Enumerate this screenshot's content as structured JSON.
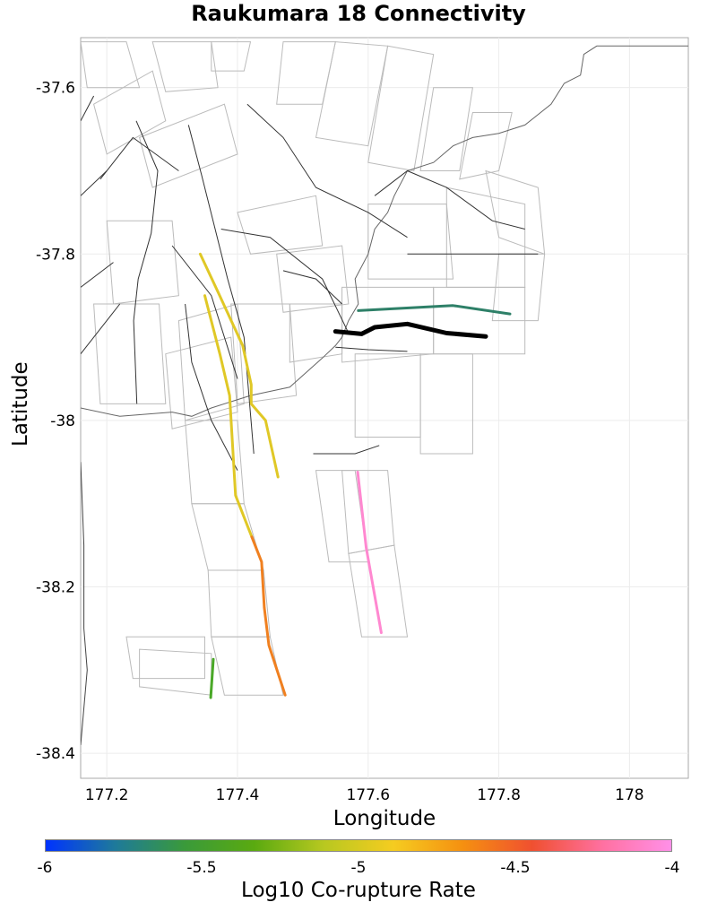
{
  "title": "Raukumara 18 Connectivity",
  "chart_data": {
    "type": "map",
    "title": "Raukumara 18 Connectivity",
    "xlabel": "Longitude",
    "ylabel": "Latitude",
    "xlim": [
      177.16,
      178.09
    ],
    "ylim": [
      -38.43,
      -37.54
    ],
    "xticks": [
      "177.2",
      "177.4",
      "177.6",
      "177.8",
      "178"
    ],
    "xtick_values": [
      177.2,
      177.4,
      177.6,
      177.8,
      178.0
    ],
    "yticks": [
      "-37.6",
      "-37.8",
      "-38",
      "-38.2",
      "-38.4"
    ],
    "ytick_values": [
      -37.6,
      -37.8,
      -38.0,
      -38.2,
      -38.4
    ],
    "grid": true,
    "colorbar": {
      "label": "Log10 Co-rupture Rate",
      "ticks": [
        "-6",
        "-5.5",
        "-5",
        "-4.5",
        "-4"
      ],
      "range": [
        -6,
        -4
      ],
      "colors": [
        "#0033ff",
        "#1e7a9a",
        "#3a9a3a",
        "#5aaa10",
        "#b8c820",
        "#f5cc20",
        "#f59010",
        "#f05030",
        "#ff70a0",
        "#ff90e8"
      ]
    },
    "target_section": {
      "name": "Raukumara 18",
      "color": "#000000",
      "points": [
        [
          177.55,
          -37.893
        ],
        [
          177.59,
          -37.896
        ],
        [
          177.61,
          -37.888
        ],
        [
          177.66,
          -37.884
        ],
        [
          177.72,
          -37.895
        ],
        [
          177.78,
          -37.899
        ]
      ]
    },
    "ruptures": [
      {
        "log10_rate": -5.6,
        "color": "#2e8068",
        "points": [
          [
            177.585,
            -37.868
          ],
          [
            177.73,
            -37.862
          ],
          [
            177.817,
            -37.872
          ]
        ]
      },
      {
        "log10_rate": -5.0,
        "color": "#e0c826",
        "points": [
          [
            177.343,
            -37.8
          ],
          [
            177.371,
            -37.847
          ],
          [
            177.408,
            -37.91
          ],
          [
            177.421,
            -37.957
          ],
          [
            177.421,
            -37.98
          ],
          [
            177.443,
            -38.0
          ],
          [
            177.462,
            -38.068
          ]
        ]
      },
      {
        "log10_rate": -5.0,
        "color": "#e0c826",
        "points": [
          [
            177.35,
            -37.85
          ],
          [
            177.373,
            -37.92
          ],
          [
            177.388,
            -37.97
          ],
          [
            177.397,
            -38.09
          ],
          [
            177.422,
            -38.14
          ]
        ]
      },
      {
        "log10_rate": -4.7,
        "color": "#f08020",
        "points": [
          [
            177.422,
            -38.14
          ],
          [
            177.437,
            -38.17
          ],
          [
            177.441,
            -38.225
          ],
          [
            177.448,
            -38.27
          ],
          [
            177.473,
            -38.33
          ]
        ]
      },
      {
        "log10_rate": -4.05,
        "color": "#ff88d0",
        "points": [
          [
            177.584,
            -38.062
          ],
          [
            177.597,
            -38.153
          ],
          [
            177.62,
            -38.255
          ]
        ]
      },
      {
        "log10_rate": -5.45,
        "color": "#4aa828",
        "points": [
          [
            177.363,
            -38.287
          ],
          [
            177.359,
            -38.333
          ]
        ]
      }
    ],
    "regional_faults": [
      [
        [
          177.245,
          -37.64
        ],
        [
          177.278,
          -37.7
        ],
        [
          177.268,
          -37.775
        ],
        [
          177.248,
          -37.83
        ],
        [
          177.241,
          -37.88
        ],
        [
          177.246,
          -37.98
        ]
      ],
      [
        [
          177.19,
          -37.71
        ],
        [
          177.24,
          -37.66
        ],
        [
          177.31,
          -37.7
        ]
      ],
      [
        [
          177.325,
          -37.645
        ],
        [
          177.345,
          -37.705
        ],
        [
          177.385,
          -37.83
        ],
        [
          177.41,
          -37.9
        ],
        [
          177.425,
          -38.04
        ]
      ],
      [
        [
          177.3,
          -37.79
        ],
        [
          177.36,
          -37.85
        ],
        [
          177.4,
          -37.95
        ]
      ],
      [
        [
          177.32,
          -37.86
        ],
        [
          177.33,
          -37.93
        ],
        [
          177.36,
          -38.0
        ],
        [
          177.4,
          -38.06
        ]
      ],
      [
        [
          177.375,
          -37.77
        ],
        [
          177.45,
          -37.78
        ],
        [
          177.53,
          -37.83
        ],
        [
          177.57,
          -37.895
        ]
      ],
      [
        [
          177.415,
          -37.62
        ],
        [
          177.47,
          -37.66
        ],
        [
          177.52,
          -37.72
        ],
        [
          177.6,
          -37.75
        ],
        [
          177.66,
          -37.78
        ]
      ],
      [
        [
          177.61,
          -37.73
        ],
        [
          177.66,
          -37.7
        ],
        [
          177.72,
          -37.72
        ],
        [
          177.79,
          -37.76
        ],
        [
          177.84,
          -37.77
        ]
      ],
      [
        [
          177.47,
          -37.82
        ],
        [
          177.52,
          -37.83
        ],
        [
          177.56,
          -37.86
        ]
      ],
      [
        [
          177.66,
          -37.8
        ],
        [
          177.75,
          -37.8
        ],
        [
          177.86,
          -37.8
        ]
      ],
      [
        [
          177.55,
          -37.912
        ],
        [
          177.6,
          -37.915
        ],
        [
          177.66,
          -37.917
        ]
      ],
      [
        [
          177.516,
          -38.04
        ],
        [
          177.58,
          -38.04
        ],
        [
          177.617,
          -38.03
        ]
      ],
      [
        [
          177.16,
          -37.73
        ],
        [
          177.2,
          -37.7
        ]
      ],
      [
        [
          177.16,
          -37.84
        ],
        [
          177.21,
          -37.81
        ]
      ],
      [
        [
          177.16,
          -37.92
        ],
        [
          177.22,
          -37.86
        ]
      ],
      [
        [
          177.16,
          -37.64
        ],
        [
          177.18,
          -37.61
        ]
      ]
    ],
    "coastline": [
      [
        177.16,
        -37.985
      ],
      [
        177.22,
        -37.995
      ],
      [
        177.3,
        -37.99
      ],
      [
        177.33,
        -37.995
      ],
      [
        177.36,
        -37.985
      ],
      [
        177.42,
        -37.97
      ],
      [
        177.48,
        -37.96
      ],
      [
        177.53,
        -37.925
      ],
      [
        177.55,
        -37.91
      ],
      [
        177.56,
        -37.9
      ],
      [
        177.57,
        -37.88
      ],
      [
        177.585,
        -37.86
      ],
      [
        177.58,
        -37.83
      ],
      [
        177.6,
        -37.8
      ],
      [
        177.61,
        -37.77
      ],
      [
        177.63,
        -37.75
      ],
      [
        177.64,
        -37.73
      ],
      [
        177.66,
        -37.7
      ],
      [
        177.7,
        -37.69
      ],
      [
        177.73,
        -37.67
      ],
      [
        177.76,
        -37.66
      ],
      [
        177.8,
        -37.655
      ],
      [
        177.84,
        -37.645
      ],
      [
        177.88,
        -37.62
      ],
      [
        177.9,
        -37.595
      ],
      [
        177.925,
        -37.585
      ],
      [
        177.93,
        -37.56
      ],
      [
        177.95,
        -37.55
      ],
      [
        177.99,
        -37.55
      ],
      [
        178.09,
        -37.55
      ]
    ],
    "southwest_coast": [
      [
        177.16,
        -38.05
      ],
      [
        177.165,
        -38.15
      ],
      [
        177.165,
        -38.25
      ],
      [
        177.17,
        -38.3
      ],
      [
        177.16,
        -38.39
      ]
    ],
    "subsection_polygons": [
      [
        [
          177.36,
          -38.26
        ],
        [
          177.45,
          -38.26
        ],
        [
          177.47,
          -38.33
        ],
        [
          177.38,
          -38.33
        ]
      ],
      [
        [
          177.355,
          -38.18
        ],
        [
          177.44,
          -38.18
        ],
        [
          177.45,
          -38.26
        ],
        [
          177.36,
          -38.26
        ]
      ],
      [
        [
          177.33,
          -38.1
        ],
        [
          177.41,
          -38.1
        ],
        [
          177.44,
          -38.18
        ],
        [
          177.355,
          -38.18
        ]
      ],
      [
        [
          177.32,
          -38.0
        ],
        [
          177.4,
          -38.0
        ],
        [
          177.41,
          -38.1
        ],
        [
          177.33,
          -38.1
        ]
      ],
      [
        [
          177.31,
          -37.88
        ],
        [
          177.4,
          -37.86
        ],
        [
          177.41,
          -37.98
        ],
        [
          177.32,
          -38.0
        ]
      ],
      [
        [
          177.23,
          -38.26
        ],
        [
          177.35,
          -38.26
        ],
        [
          177.35,
          -38.31
        ],
        [
          177.24,
          -38.31
        ]
      ],
      [
        [
          177.25,
          -38.275
        ],
        [
          177.36,
          -38.28
        ],
        [
          177.36,
          -38.33
        ],
        [
          177.25,
          -38.32
        ]
      ],
      [
        [
          177.56,
          -38.06
        ],
        [
          177.63,
          -38.06
        ],
        [
          177.64,
          -38.15
        ],
        [
          177.57,
          -38.16
        ]
      ],
      [
        [
          177.57,
          -38.16
        ],
        [
          177.64,
          -38.15
        ],
        [
          177.66,
          -38.26
        ],
        [
          177.59,
          -38.26
        ]
      ],
      [
        [
          177.52,
          -38.06
        ],
        [
          177.58,
          -38.06
        ],
        [
          177.6,
          -38.17
        ],
        [
          177.54,
          -38.17
        ]
      ],
      [
        [
          177.56,
          -37.84
        ],
        [
          177.7,
          -37.84
        ],
        [
          177.7,
          -37.92
        ],
        [
          177.56,
          -37.93
        ]
      ],
      [
        [
          177.7,
          -37.84
        ],
        [
          177.84,
          -37.84
        ],
        [
          177.84,
          -37.92
        ],
        [
          177.7,
          -37.92
        ]
      ],
      [
        [
          177.58,
          -37.92
        ],
        [
          177.68,
          -37.92
        ],
        [
          177.68,
          -38.02
        ],
        [
          177.58,
          -38.02
        ]
      ],
      [
        [
          177.68,
          -37.92
        ],
        [
          177.76,
          -37.92
        ],
        [
          177.76,
          -38.04
        ],
        [
          177.68,
          -38.04
        ]
      ],
      [
        [
          177.6,
          -37.74
        ],
        [
          177.72,
          -37.74
        ],
        [
          177.73,
          -37.83
        ],
        [
          177.6,
          -37.83
        ]
      ],
      [
        [
          177.72,
          -37.72
        ],
        [
          177.84,
          -37.74
        ],
        [
          177.84,
          -37.84
        ],
        [
          177.72,
          -37.84
        ]
      ],
      [
        [
          177.46,
          -37.8
        ],
        [
          177.56,
          -37.79
        ],
        [
          177.57,
          -37.86
        ],
        [
          177.47,
          -37.87
        ]
      ],
      [
        [
          177.4,
          -37.75
        ],
        [
          177.52,
          -37.73
        ],
        [
          177.53,
          -37.79
        ],
        [
          177.42,
          -37.8
        ]
      ],
      [
        [
          177.2,
          -37.76
        ],
        [
          177.3,
          -37.76
        ],
        [
          177.31,
          -37.85
        ],
        [
          177.21,
          -37.86
        ]
      ],
      [
        [
          177.18,
          -37.86
        ],
        [
          177.28,
          -37.86
        ],
        [
          177.29,
          -37.98
        ],
        [
          177.19,
          -37.98
        ]
      ],
      [
        [
          177.29,
          -37.92
        ],
        [
          177.39,
          -37.9
        ],
        [
          177.4,
          -37.99
        ],
        [
          177.3,
          -38.01
        ]
      ],
      [
        [
          177.39,
          -37.86
        ],
        [
          177.48,
          -37.86
        ],
        [
          177.49,
          -37.97
        ],
        [
          177.4,
          -37.98
        ]
      ],
      [
        [
          177.25,
          -37.66
        ],
        [
          177.38,
          -37.62
        ],
        [
          177.4,
          -37.68
        ],
        [
          177.27,
          -37.72
        ]
      ],
      [
        [
          177.18,
          -37.62
        ],
        [
          177.27,
          -37.58
        ],
        [
          177.29,
          -37.64
        ],
        [
          177.2,
          -37.68
        ]
      ],
      [
        [
          177.27,
          -37.545
        ],
        [
          177.36,
          -37.545
        ],
        [
          177.37,
          -37.6
        ],
        [
          177.29,
          -37.605
        ]
      ],
      [
        [
          177.36,
          -37.545
        ],
        [
          177.42,
          -37.545
        ],
        [
          177.41,
          -37.58
        ],
        [
          177.36,
          -37.58
        ]
      ],
      [
        [
          177.16,
          -37.545
        ],
        [
          177.23,
          -37.545
        ],
        [
          177.25,
          -37.6
        ],
        [
          177.17,
          -37.6
        ]
      ],
      [
        [
          177.47,
          -37.545
        ],
        [
          177.55,
          -37.545
        ],
        [
          177.53,
          -37.62
        ],
        [
          177.46,
          -37.62
        ]
      ],
      [
        [
          177.55,
          -37.545
        ],
        [
          177.63,
          -37.55
        ],
        [
          177.6,
          -37.67
        ],
        [
          177.52,
          -37.66
        ]
      ],
      [
        [
          177.63,
          -37.55
        ],
        [
          177.7,
          -37.56
        ],
        [
          177.67,
          -37.7
        ],
        [
          177.6,
          -37.69
        ]
      ],
      [
        [
          177.7,
          -37.6
        ],
        [
          177.76,
          -37.6
        ],
        [
          177.74,
          -37.7
        ],
        [
          177.68,
          -37.7
        ]
      ],
      [
        [
          177.76,
          -37.63
        ],
        [
          177.82,
          -37.63
        ],
        [
          177.8,
          -37.7
        ],
        [
          177.74,
          -37.71
        ]
      ],
      [
        [
          177.78,
          -37.7
        ],
        [
          177.86,
          -37.72
        ],
        [
          177.87,
          -37.8
        ],
        [
          177.8,
          -37.78
        ]
      ],
      [
        [
          177.8,
          -37.8
        ],
        [
          177.87,
          -37.8
        ],
        [
          177.86,
          -37.88
        ],
        [
          177.79,
          -37.88
        ]
      ],
      [
        [
          177.48,
          -37.86
        ],
        [
          177.56,
          -37.86
        ],
        [
          177.56,
          -37.92
        ],
        [
          177.48,
          -37.93
        ]
      ]
    ]
  }
}
